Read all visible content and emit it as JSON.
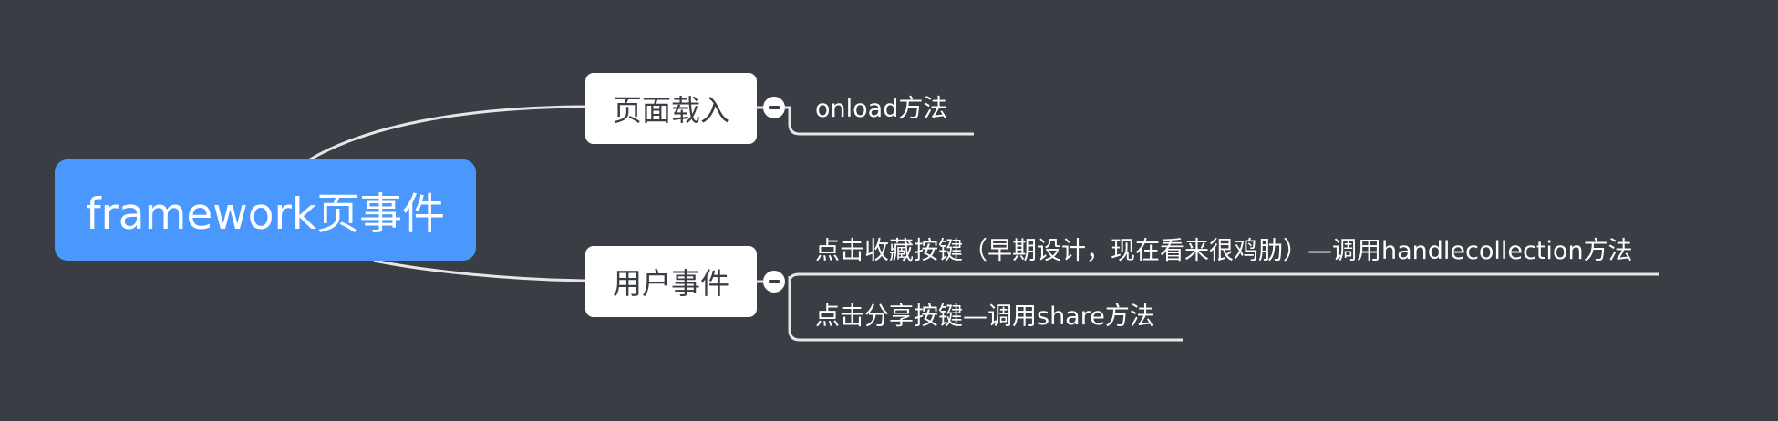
{
  "mindmap": {
    "root": {
      "label": "framework页事件"
    },
    "branches": [
      {
        "label": "页面载入",
        "children": [
          {
            "label": "onload方法"
          }
        ]
      },
      {
        "label": "用户事件",
        "children": [
          {
            "label": "点击收藏按键（早期设计，现在看来很鸡肋）—调用handlecollection方法"
          },
          {
            "label": "点击分享按键—调用share方法"
          }
        ]
      }
    ]
  },
  "colors": {
    "background": "#3a3d43",
    "root_fill": "#4a98fe",
    "branch_fill": "#ffffff",
    "connector": "#e6e6e6",
    "text_light": "#ffffff",
    "text_dark": "#3a3d43"
  }
}
